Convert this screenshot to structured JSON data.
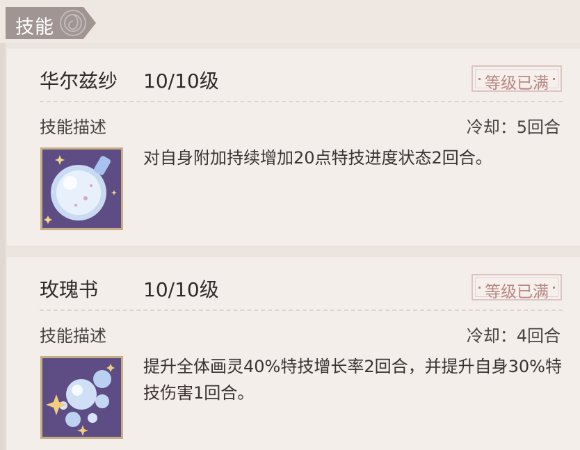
{
  "section": {
    "title": "技能"
  },
  "skills": [
    {
      "name": "华尔兹纱",
      "level": "10/10级",
      "badge": "等级已满",
      "desc_label": "技能描述",
      "cooldown": "冷却：5回合",
      "description": "对自身附加持续增加20点特技进度状态2回合。",
      "icon": "crystal-orb-icon"
    },
    {
      "name": "玫瑰书",
      "level": "10/10级",
      "badge": "等级已满",
      "desc_label": "技能描述",
      "cooldown": "冷却：4回合",
      "description": "提升全体画灵40%特技增长率2回合，并提升自身30%特技伤害1回合。",
      "icon": "bubbles-sparkle-icon"
    }
  ],
  "colors": {
    "tab_bg": "#a09593",
    "badge_text": "#b88783",
    "icon_frame": "#c6ad84",
    "icon_bg": "#5e4d85"
  }
}
